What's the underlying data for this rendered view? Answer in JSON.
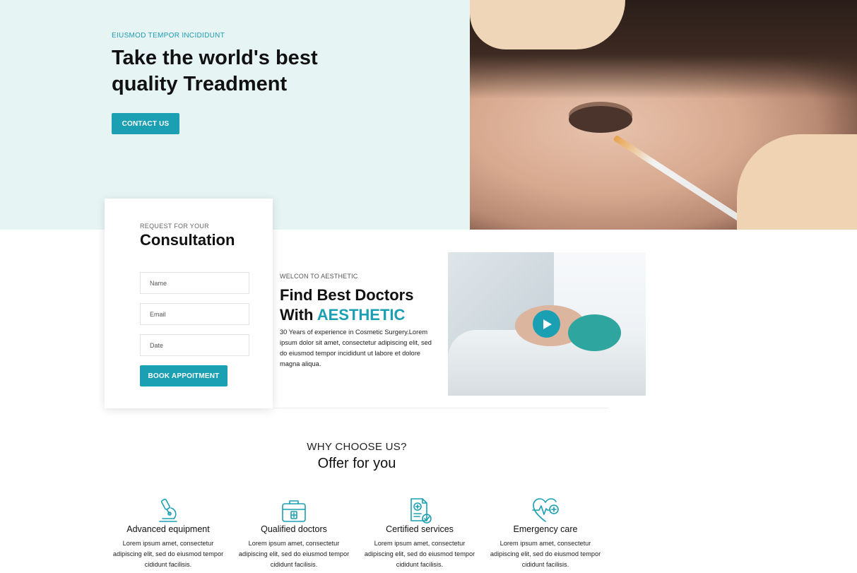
{
  "hero": {
    "eyebrow": "EIUSMOD TEMPOR INCIDIDUNT",
    "title": "Take the world's best quality Treadment",
    "contact_button": "CONTACT US"
  },
  "consultation": {
    "subtitle": "REQUEST FOR YOUR",
    "title": "Consultation",
    "fields": {
      "name_placeholder": "Name",
      "email_placeholder": "Email",
      "date_placeholder": "Date"
    },
    "book_button": "BOOK APPOITMENT"
  },
  "welcome": {
    "subtitle": "WELCON TO AESTHETIC",
    "title_prefix": "Find Best Doctors With ",
    "title_accent": "AESTHETIC",
    "text": "30 Years of experience in Cosmetic Surgery.Lorem ipsum dolor sit amet, consectetur adipiscing elit, sed do eiusmod tempor incididunt ut labore et dolore magna aliqua."
  },
  "why": {
    "subtitle": "WHY CHOOSE US?",
    "title": "Offer for you"
  },
  "features": [
    {
      "icon": "microscope-icon",
      "title": "Advanced equipment",
      "desc": "Lorem ipsum amet, consectetur adipiscing elit, sed do eiusmod tempor cididunt facilisis."
    },
    {
      "icon": "medical-kit-icon",
      "title": "Qualified doctors",
      "desc": "Lorem ipsum amet, consectetur adipiscing elit, sed do eiusmod tempor cididunt facilisis."
    },
    {
      "icon": "certificate-icon",
      "title": "Certified services",
      "desc": "Lorem ipsum amet, consectetur adipiscing elit, sed do eiusmod tempor cididunt facilisis."
    },
    {
      "icon": "heart-pulse-icon",
      "title": "Emergency care",
      "desc": "Lorem ipsum amet, consectetur adipiscing elit, sed do eiusmod tempor cididunt facilisis."
    }
  ],
  "colors": {
    "accent": "#1a9fb3",
    "hero_background": "#e6f4f4",
    "text_dark": "#111111"
  }
}
